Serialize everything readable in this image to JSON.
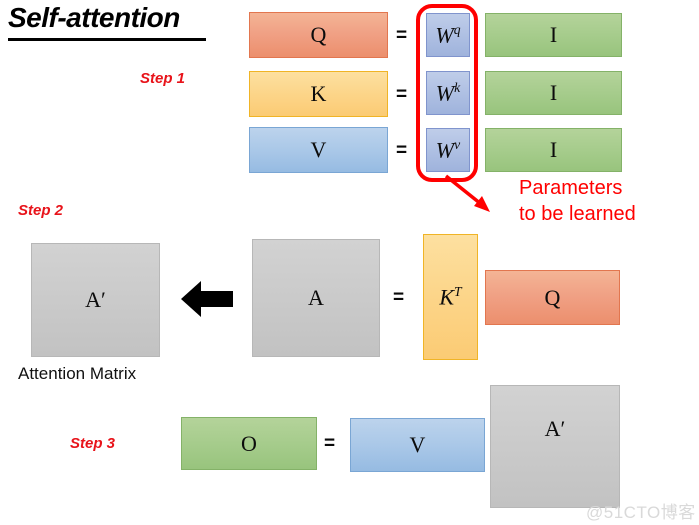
{
  "slide": {
    "title": "Self-attention",
    "background_color": "#ffffff",
    "watermark": "@51CTO博客"
  },
  "steps": [
    {
      "id": "step1",
      "label": "Step 1"
    },
    {
      "id": "step2",
      "label": "Step 2"
    },
    {
      "id": "step3",
      "label": "Step 3"
    }
  ],
  "callout": {
    "line1": "Parameters",
    "line2": "to be learned",
    "color": "#ff0000",
    "highlight_target": "weight-matrices"
  },
  "labels": {
    "attention_matrix": "Attention Matrix"
  },
  "equations": {
    "step1": [
      {
        "lhs": "Q",
        "lhs_color": "#ee9170",
        "equals": "=",
        "weight": "W",
        "weight_superscript": "q",
        "weight_color": "#a9bce1",
        "input": "I",
        "input_color": "#a6cc8c"
      },
      {
        "lhs": "K",
        "lhs_color": "#fbd285",
        "equals": "=",
        "weight": "W",
        "weight_superscript": "k",
        "weight_color": "#a9bce1",
        "input": "I",
        "input_color": "#a6cc8c"
      },
      {
        "lhs": "V",
        "lhs_color": "#a9c8e6",
        "equals": "=",
        "weight": "W",
        "weight_superscript": "v",
        "weight_color": "#a9bce1",
        "input": "I",
        "input_color": "#a6cc8c"
      }
    ],
    "step2": {
      "result": "A′",
      "result_color": "#cacaca",
      "arrow": "left-block-arrow",
      "source": "A",
      "source_color": "#cacaca",
      "equals": "=",
      "factor1": "K",
      "factor1_superscript": "T",
      "factor1_color": "#fbd285",
      "factor2": "Q",
      "factor2_color": "#ee9170"
    },
    "step3": {
      "result": "O",
      "result_color": "#a6cc8c",
      "equals": "=",
      "factor1": "V",
      "factor1_color": "#a9c8e6",
      "factor2": "A′",
      "factor2_color": "#cacaca"
    }
  }
}
